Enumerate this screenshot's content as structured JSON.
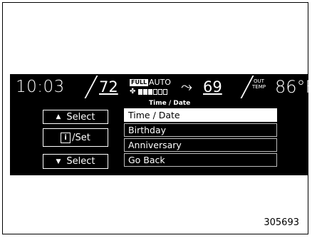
{
  "status": {
    "time": "10:03",
    "driver_temp": "72",
    "fan_mode_badge": "FULL",
    "climate_mode": "AUTO",
    "fan_level": 3,
    "fan_level_max": 6,
    "passenger_temp": "69",
    "outside_temp_label_line1": "OUT",
    "outside_temp_label_line2": "TEMP",
    "outside_temp_value": "86°F"
  },
  "submenu_title": "Time / Date",
  "buttons": {
    "select_up_label": "Select",
    "set_label": "/Set",
    "info_glyph": "i",
    "select_down_label": "Select"
  },
  "menu": {
    "items": [
      {
        "label": "Time / Date",
        "selected": true
      },
      {
        "label": "Birthday",
        "selected": false
      },
      {
        "label": "Anniversary",
        "selected": false
      },
      {
        "label": "Go Back",
        "selected": false
      }
    ]
  },
  "figure_number": "305693",
  "icons": [
    "up-triangle-icon",
    "info-icon",
    "down-triangle-icon",
    "fan-icon",
    "airflow-icon"
  ]
}
